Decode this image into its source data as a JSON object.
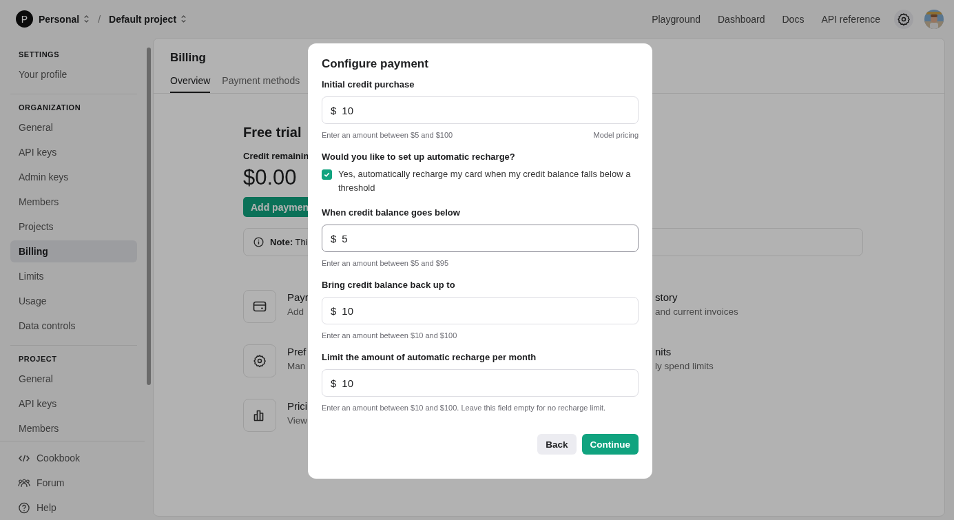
{
  "topbar": {
    "org_initial": "P",
    "org": "Personal",
    "separator": "/",
    "project": "Default project",
    "links": [
      "Playground",
      "Dashboard",
      "Docs",
      "API reference"
    ]
  },
  "sidebar": {
    "sections": [
      {
        "heading": "SETTINGS",
        "items": [
          {
            "label": "Your profile",
            "selected": false
          }
        ]
      },
      {
        "heading": "ORGANIZATION",
        "items": [
          {
            "label": "General",
            "selected": false
          },
          {
            "label": "API keys",
            "selected": false
          },
          {
            "label": "Admin keys",
            "selected": false
          },
          {
            "label": "Members",
            "selected": false
          },
          {
            "label": "Projects",
            "selected": false
          },
          {
            "label": "Billing",
            "selected": true
          },
          {
            "label": "Limits",
            "selected": false
          },
          {
            "label": "Usage",
            "selected": false
          },
          {
            "label": "Data controls",
            "selected": false
          }
        ]
      },
      {
        "heading": "PROJECT",
        "items": [
          {
            "label": "General",
            "selected": false
          },
          {
            "label": "API keys",
            "selected": false
          },
          {
            "label": "Members",
            "selected": false
          }
        ]
      }
    ],
    "footer": [
      {
        "kind": "code",
        "label": "Cookbook"
      },
      {
        "kind": "people",
        "label": "Forum"
      },
      {
        "kind": "help",
        "label": "Help"
      }
    ]
  },
  "page": {
    "title": "Billing",
    "tabs": [
      {
        "label": "Overview",
        "selected": true
      },
      {
        "label": "Payment methods",
        "selected": false
      }
    ],
    "plan": "Free trial",
    "credit_label": "Credit remainin",
    "credit": "$0.00",
    "add_button": "Add paymen",
    "note": "**Note:** Thi",
    "cards": [
      {
        "kind": "card",
        "title": "Payr",
        "desc": "Add"
      },
      {
        "kind": "gear",
        "title": "Pref",
        "desc": "Man"
      },
      {
        "kind": "chart",
        "title": "Prici",
        "desc": "View"
      }
    ],
    "right_cards": [
      {
        "title": "story",
        "desc": "and current invoices"
      },
      {
        "title": "nits",
        "desc": "ly spend limits"
      }
    ]
  },
  "dialog": {
    "title": "Configure payment",
    "first_field": {
      "label": "Initial credit purchase",
      "prefix": "$",
      "value": "10",
      "focused": false,
      "hint": "Enter an amount between $5 and $100",
      "link": "Model pricing"
    },
    "question": "Would you like to set up automatic recharge?",
    "checkbox": {
      "label": "Yes, automatically recharge my card when my credit balance falls below a threshold",
      "checked": true
    },
    "fields": [
      {
        "label": "When credit balance goes below",
        "prefix": "$",
        "value": "5",
        "focused": true,
        "hint": "Enter an amount between $5 and $95"
      },
      {
        "label": "Bring credit balance back up to",
        "prefix": "$",
        "value": "10",
        "focused": false,
        "hint": "Enter an amount between $10 and $100"
      },
      {
        "label": "Limit the amount of automatic recharge per month",
        "prefix": "$",
        "value": "10",
        "focused": false,
        "hint": "Enter an amount between $10 and $100. Leave this field empty for no recharge limit."
      }
    ],
    "buttons": [
      {
        "kind": "secondary",
        "label": "Back"
      },
      {
        "kind": "primary",
        "label": "Continue"
      }
    ]
  }
}
